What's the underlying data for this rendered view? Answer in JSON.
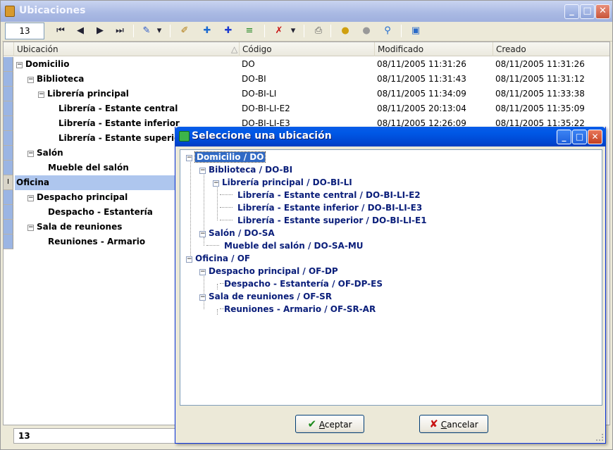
{
  "app": {
    "title": "Ubicaciones",
    "record_field_value": "13",
    "footer_value": "13"
  },
  "title_buttons": {
    "minimize": "_",
    "maximize": "□",
    "close": "✕"
  },
  "toolbar": {
    "first_icon": "⏮",
    "prev_icon": "◀",
    "next_icon": "▶",
    "last_icon": "⏭",
    "edit_icon": "✎",
    "dropdown_icon": "▾",
    "pencil_icon": "✐",
    "add_icon": "✚",
    "add_child_icon": "✚",
    "list_icon": "≡",
    "delete_icon": "✗",
    "print_icon": "⎙",
    "filter_icon": "●",
    "find_icon": "⚲",
    "exit_icon": "▣"
  },
  "grid": {
    "columns": [
      "Ubicación",
      "Código",
      "Modificado",
      "Creado"
    ],
    "sort_indicator": "△",
    "rows": [
      {
        "name": "Domicilio",
        "code": "DO",
        "modified": "08/11/2005 11:31:26",
        "created": "08/11/2005 11:31:26"
      },
      {
        "name": "Biblioteca",
        "code": "DO-BI",
        "modified": "08/11/2005 11:31:43",
        "created": "08/11/2005 11:31:12"
      },
      {
        "name": "Librería principal",
        "code": "DO-BI-LI",
        "modified": "08/11/2005 11:34:09",
        "created": "08/11/2005 11:33:38"
      },
      {
        "name": "Librería - Estante central",
        "code": "DO-BI-LI-E2",
        "modified": "08/11/2005 20:13:04",
        "created": "08/11/2005 11:35:09"
      },
      {
        "name": "Librería - Estante inferior",
        "code": "DO-BI-LI-E3",
        "modified": "08/11/2005 12:26:09",
        "created": "08/11/2005 11:35:22"
      },
      {
        "name": "Librería - Estante superior",
        "code": "",
        "modified": "",
        "created": ""
      },
      {
        "name": "Salón",
        "code": "",
        "modified": "",
        "created": ""
      },
      {
        "name": "Mueble del salón",
        "code": "",
        "modified": "",
        "created": ""
      },
      {
        "name": "Oficina",
        "code": "",
        "modified": "",
        "created": ""
      },
      {
        "name": "Despacho principal",
        "code": "",
        "modified": "",
        "created": ""
      },
      {
        "name": "Despacho - Estantería",
        "code": "",
        "modified": "",
        "created": ""
      },
      {
        "name": "Sala de reuniones",
        "code": "",
        "modified": "",
        "created": ""
      },
      {
        "name": "Reuniones - Armario",
        "code": "",
        "modified": "",
        "created": ""
      }
    ],
    "editing_marker": "I"
  },
  "dialog": {
    "title": "Seleccione una ubicación",
    "tree": [
      "Domicilio / DO",
      "Biblioteca / DO-BI",
      "Librería principal / DO-BI-LI",
      "Librería - Estante central / DO-BI-LI-E2",
      "Librería - Estante inferior / DO-BI-LI-E3",
      "Librería - Estante superior / DO-BI-LI-E1",
      "Salón / DO-SA",
      "Mueble del salón / DO-SA-MU",
      "Oficina / OF",
      "Despacho principal / OF-DP",
      "Despacho - Estantería / OF-DP-ES",
      "Sala de reuniones / OF-SR",
      "Reuniones - Armario / OF-SR-AR"
    ],
    "accept": {
      "u": "A",
      "rest": "ceptar",
      "icon": "✔"
    },
    "cancel": {
      "u": "C",
      "rest": "ancelar",
      "icon": "✘"
    }
  },
  "colors": {
    "accept_icon": "#1c8a1c",
    "cancel_icon": "#c81414",
    "tree_text": "#0a1e7a",
    "selection": "#316ac5"
  }
}
